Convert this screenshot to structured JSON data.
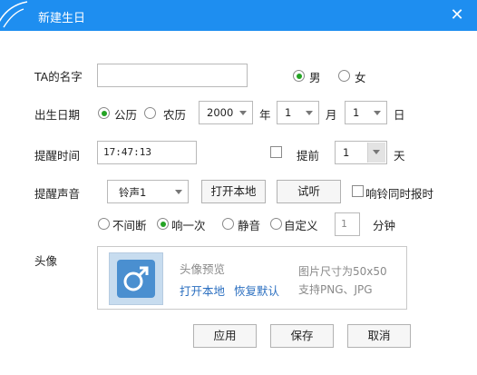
{
  "window": {
    "title": "新建生日"
  },
  "name": {
    "label": "TA的名字",
    "value": ""
  },
  "gender": {
    "male": "男",
    "female": "女",
    "selected": "male"
  },
  "birthday": {
    "label": "出生日期",
    "calendar_solar": "公历",
    "calendar_lunar": "农历",
    "selected_calendar": "solar",
    "year": "2000",
    "year_unit": "年",
    "month": "1",
    "month_unit": "月",
    "day": "1",
    "day_unit": "日"
  },
  "remind_time": {
    "label": "提醒时间",
    "value": "17:47:13",
    "advance_label": "提前",
    "advance_checked": false,
    "advance_days": "1",
    "advance_unit": "天"
  },
  "remind_sound": {
    "label": "提醒声音",
    "sound": "铃声1",
    "open_local": "打开本地",
    "preview": "试听",
    "report_time_label": "响铃同时报时",
    "report_time_checked": false,
    "modes": [
      "不间断",
      "响一次",
      "静音",
      "自定义"
    ],
    "selected_mode": "响一次",
    "custom_minutes": "1",
    "minutes_unit": "分钟"
  },
  "avatar": {
    "label": "头像",
    "preview_title": "头像预览",
    "open_local": "打开本地",
    "restore_default": "恢复默认",
    "size_hint": "图片尺寸为50x50",
    "format_hint": "支持PNG、JPG"
  },
  "actions": {
    "apply": "应用",
    "save": "保存",
    "cancel": "取消"
  },
  "colors": {
    "titlebar": "#1e8ef0",
    "radio_selected": "#24a324",
    "link": "#2b6fc0",
    "avatar_bg": "#4a8fd0"
  }
}
